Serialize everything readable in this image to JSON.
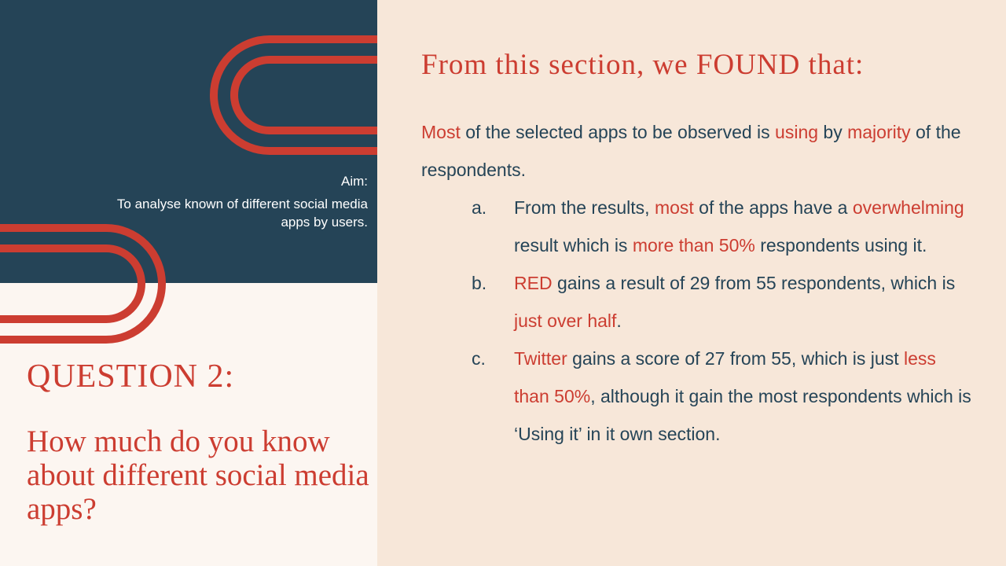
{
  "aim": {
    "label": "Aim:",
    "text": "To analyse known of different social media apps by users."
  },
  "question": {
    "heading": "QUESTION 2:",
    "body": "How much do you know about different social media apps?"
  },
  "findings": {
    "title": "From this section, we FOUND that:",
    "intro": [
      {
        "t": "Most",
        "hl": true
      },
      {
        "t": " of the selected apps to be observed is ",
        "hl": false
      },
      {
        "t": "using",
        "hl": true
      },
      {
        "t": " by ",
        "hl": false
      },
      {
        "t": "majority",
        "hl": true
      },
      {
        "t": " of the respondents.",
        "hl": false
      }
    ],
    "items": [
      {
        "marker": "a.",
        "parts": [
          {
            "t": "From the results, ",
            "hl": false
          },
          {
            "t": "most",
            "hl": true
          },
          {
            "t": " of the apps have a ",
            "hl": false
          },
          {
            "t": "overwhelming",
            "hl": true
          },
          {
            "t": " result which is ",
            "hl": false
          },
          {
            "t": "more than 50%",
            "hl": true
          },
          {
            "t": " respondents using it.",
            "hl": false
          }
        ]
      },
      {
        "marker": "b.",
        "parts": [
          {
            "t": "RED",
            "hl": true
          },
          {
            "t": " gains a result of 29 from 55 respondents, which is ",
            "hl": false
          },
          {
            "t": "just over half",
            "hl": true
          },
          {
            "t": ".",
            "hl": false
          }
        ]
      },
      {
        "marker": "c.",
        "parts": [
          {
            "t": "Twitter",
            "hl": true
          },
          {
            "t": " gains a score of 27 from 55, which is just ",
            "hl": false
          },
          {
            "t": "less than 50%",
            "hl": true
          },
          {
            "t": ", although it gain the most respondents which is ‘Using it’ in it own section.",
            "hl": false
          }
        ]
      }
    ]
  },
  "colors": {
    "navy": "#254457",
    "red": "#cc3d31",
    "cream": "#fcf6f1",
    "peach": "#f7e7d9"
  }
}
